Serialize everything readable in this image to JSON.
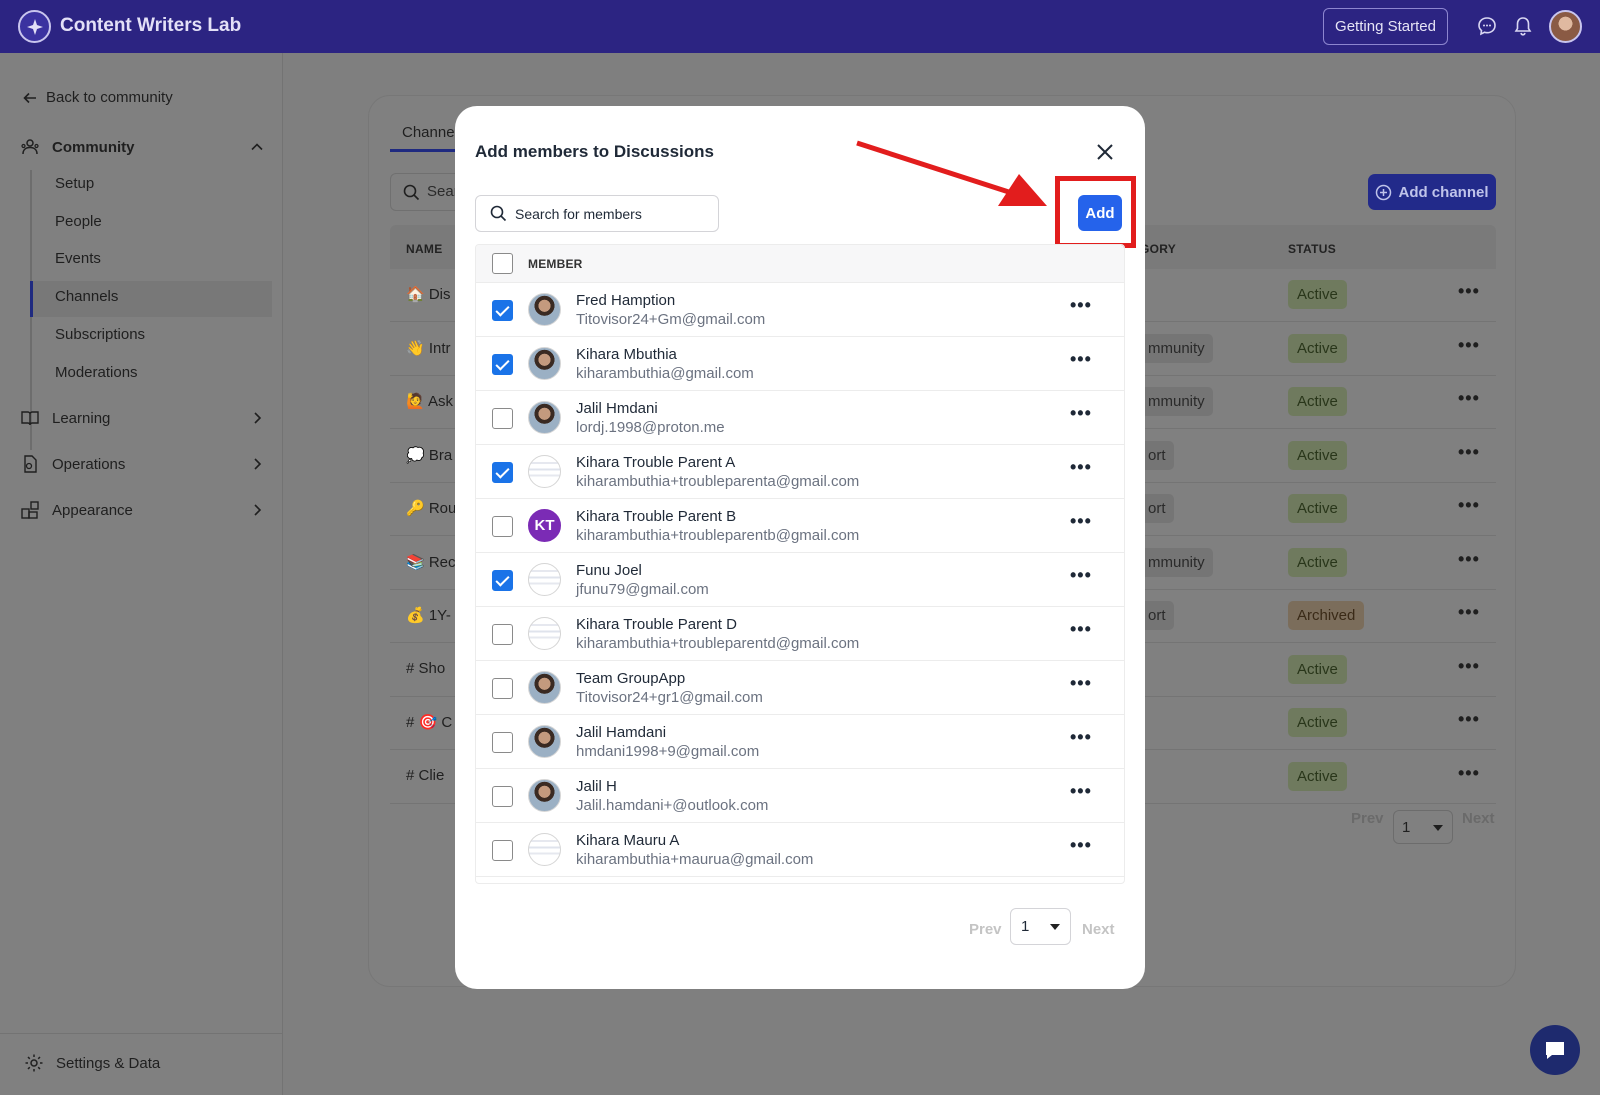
{
  "app": {
    "title": "Content Writers Lab",
    "getting_started": "Getting Started"
  },
  "sidebar": {
    "back": "Back to community",
    "community": "Community",
    "community_items": [
      "Setup",
      "People",
      "Events",
      "Channels",
      "Subscriptions",
      "Moderations"
    ],
    "active_item": "Channels",
    "learning": "Learning",
    "operations": "Operations",
    "appearance": "Appearance",
    "settings": "Settings & Data"
  },
  "background": {
    "tab": "Channel",
    "search_placeholder": "Sear",
    "add_channel": "Add channel",
    "columns": {
      "name": "NAME",
      "category": "GORY",
      "status": "STATUS"
    },
    "rows": [
      {
        "name": "🏠 Dis",
        "category": "",
        "status": "Active"
      },
      {
        "name": "👋 Intr",
        "category": "mmunity",
        "status": "Active"
      },
      {
        "name": "🙋 Ask",
        "category": "mmunity",
        "status": "Active"
      },
      {
        "name": "💭 Bra",
        "category": "ort",
        "status": "Active"
      },
      {
        "name": "🔑 Rou",
        "category": "ort",
        "status": "Active"
      },
      {
        "name": "📚 Rec",
        "category": "mmunity",
        "status": "Active"
      },
      {
        "name": "💰 1Y-",
        "category": "ort",
        "status": "Archived"
      },
      {
        "name": "#  Sho",
        "category": "",
        "status": "Active"
      },
      {
        "name": "#  🎯 C",
        "category": "",
        "status": "Active"
      },
      {
        "name": "#  Clie",
        "category": "",
        "status": "Active"
      }
    ],
    "pager": {
      "prev": "Prev",
      "page": "1",
      "next": "Next"
    }
  },
  "modal": {
    "title": "Add members to Discussions",
    "search_placeholder": "Search for members",
    "add_label": "Add",
    "column_member": "MEMBER",
    "members": [
      {
        "name": "Fred Hamption",
        "email": "Titovisor24+Gm@gmail.com",
        "checked": true,
        "avatar": "photo"
      },
      {
        "name": "Kihara Mbuthia",
        "email": "kiharambuthia@gmail.com",
        "checked": true,
        "avatar": "photo"
      },
      {
        "name": "Jalil Hmdani",
        "email": "lordj.1998@proton.me",
        "checked": false,
        "avatar": "photo"
      },
      {
        "name": "Kihara Trouble Parent A",
        "email": "kiharambuthia+troubleparenta@gmail.com",
        "checked": true,
        "avatar": "screenshot"
      },
      {
        "name": "Kihara Trouble Parent B",
        "email": "kiharambuthia+troubleparentb@gmail.com",
        "checked": false,
        "avatar": "initials",
        "initials": "KT"
      },
      {
        "name": "Funu Joel",
        "email": "jfunu79@gmail.com",
        "checked": true,
        "avatar": "screenshot"
      },
      {
        "name": "Kihara Trouble Parent D",
        "email": "kiharambuthia+troubleparentd@gmail.com",
        "checked": false,
        "avatar": "screenshot"
      },
      {
        "name": "Team GroupApp",
        "email": "Titovisor24+gr1@gmail.com",
        "checked": false,
        "avatar": "photo"
      },
      {
        "name": "Jalil Hamdani",
        "email": "hmdani1998+9@gmail.com",
        "checked": false,
        "avatar": "photo"
      },
      {
        "name": "Jalil H",
        "email": "Jalil.hamdani+@outlook.com",
        "checked": false,
        "avatar": "photo"
      },
      {
        "name": "Kihara Mauru A",
        "email": "kiharambuthia+maurua@gmail.com",
        "checked": false,
        "avatar": "screenshot"
      }
    ],
    "pager": {
      "prev": "Prev",
      "page": "1",
      "next": "Next"
    }
  },
  "colors": {
    "brand": "#2c2482",
    "add_button": "#2563eb",
    "highlight": "#e21d1d",
    "checkbox": "#1a73e8"
  }
}
